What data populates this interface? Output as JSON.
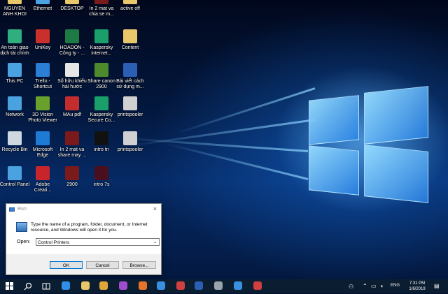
{
  "desktop": {
    "icons": [
      {
        "label": "NGUYEN\nANH KHOI",
        "icon": "user-folder-icon",
        "color": "#e8c66a"
      },
      {
        "label": "Ethernet",
        "icon": "network-icon",
        "color": "#4aa3e0"
      },
      {
        "label": "DESKTOP",
        "icon": "folder-icon",
        "color": "#e8c66a"
      },
      {
        "label": "In 2 mat va\nchia se m...",
        "icon": "video-file-icon",
        "color": "#7a1a1a"
      },
      {
        "label": "active off",
        "icon": "folder-icon",
        "color": "#e8c66a"
      },
      {
        "label": "An toàn giao\ndịch tài chính",
        "icon": "shield-app-icon",
        "color": "#2fae7e"
      },
      {
        "label": "UniKey",
        "icon": "unikey-icon",
        "color": "#c9302c"
      },
      {
        "label": "HOADON -\nCông ty - ...",
        "icon": "excel-file-icon",
        "color": "#1d7a45"
      },
      {
        "label": "Kaspersky\ninternet...",
        "icon": "kaspersky-icon",
        "color": "#1a9e6a"
      },
      {
        "label": "Content",
        "icon": "folder-icon",
        "color": "#e8c66a"
      },
      {
        "label": "This PC",
        "icon": "this-pc-icon",
        "color": "#4aa3e0"
      },
      {
        "label": "Trello -\nShortcut",
        "icon": "trello-icon",
        "color": "#2b7fd4"
      },
      {
        "label": "Sổ hữu khiếu\nhài hước",
        "icon": "document-icon",
        "color": "#e6e6e6"
      },
      {
        "label": "Share canon\n2900",
        "icon": "image-file-icon",
        "color": "#4c8a2c"
      },
      {
        "label": "Bài viết cách\nsử dụng m...",
        "icon": "word-file-icon",
        "color": "#2b5fb4"
      },
      {
        "label": "Network",
        "icon": "network-globe-icon",
        "color": "#4aa3e0"
      },
      {
        "label": "3D Vision\nPhoto Viewer",
        "icon": "nvidia-icon",
        "color": "#6aa02c"
      },
      {
        "label": "MAu pdf",
        "icon": "pdf-file-icon",
        "color": "#c42d2d"
      },
      {
        "label": "Kaspersky\nSecure Co...",
        "icon": "kaspersky-secure-icon",
        "color": "#1a9e6a"
      },
      {
        "label": "printspooler",
        "icon": "printer-icon",
        "color": "#d0d0d0"
      },
      {
        "label": "Recycle Bin",
        "icon": "recycle-bin-icon",
        "color": "#cfd8e0"
      },
      {
        "label": "Microsoft\nEdge",
        "icon": "edge-icon",
        "color": "#1f7ad6"
      },
      {
        "label": "In 2 mat va\nshare may ...",
        "icon": "video-file-icon",
        "color": "#7a1a1a"
      },
      {
        "label": "intro tn",
        "icon": "video-file-icon",
        "color": "#111111"
      },
      {
        "label": "printspooler",
        "icon": "printer-icon",
        "color": "#d0d0d0"
      },
      {
        "label": "Control Panel",
        "icon": "control-panel-icon",
        "color": "#4aa3e0"
      },
      {
        "label": "Adobe\nCreati...",
        "icon": "adobe-cc-icon",
        "color": "#c8242b"
      },
      {
        "label": "2900",
        "icon": "video-file-icon",
        "color": "#7a1a1a"
      },
      {
        "label": "intro 7s",
        "icon": "video-file-icon",
        "color": "#4a0f1e"
      }
    ]
  },
  "run_dialog": {
    "title": "Run",
    "close_glyph": "×",
    "description": "Type the name of a program, folder, document, or Internet resource, and Windows will open it for you.",
    "open_label": "Open:",
    "open_value": "Control Printers",
    "ok_label": "OK",
    "cancel_label": "Cancel",
    "browse_label": "Browse..."
  },
  "taskbar": {
    "pinned": [
      {
        "icon": "windows-start-icon",
        "color": "#ffffff"
      },
      {
        "icon": "search-icon",
        "color": "#ffffff"
      },
      {
        "icon": "task-view-icon",
        "color": "#ffffff"
      },
      {
        "icon": "edge-icon",
        "color": "#2f8fe8"
      },
      {
        "icon": "file-explorer-icon",
        "color": "#e8c66a"
      },
      {
        "icon": "chrome-icon",
        "color": "#e0a63a"
      },
      {
        "icon": "firefox-icon",
        "color": "#a04ccf"
      },
      {
        "icon": "firefox-icon",
        "color": "#e8742a"
      },
      {
        "icon": "store-icon",
        "color": "#3a8fe0"
      },
      {
        "icon": "mail-icon",
        "color": "#d04040"
      },
      {
        "icon": "word-icon",
        "color": "#2b5fb4"
      },
      {
        "icon": "remote-desktop-icon",
        "color": "#9aa4ad"
      },
      {
        "icon": "app-icon",
        "color": "#3a8fe0"
      },
      {
        "icon": "app-icon",
        "color": "#d04040"
      }
    ],
    "language": "ENG",
    "time": "7:31 PM",
    "date": "1/6/2019"
  }
}
